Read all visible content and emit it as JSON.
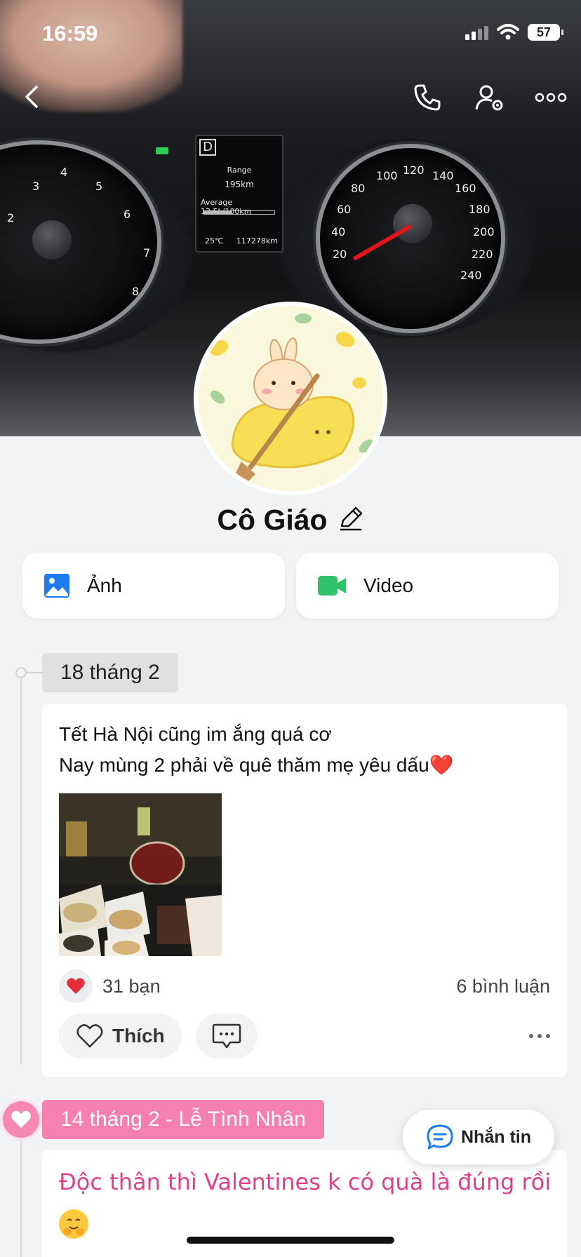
{
  "status_bar": {
    "time": "16:59",
    "battery": "57"
  },
  "profile": {
    "name": "Cô Giáo"
  },
  "actions": {
    "photo_label": "Ảnh",
    "video_label": "Video"
  },
  "posts": [
    {
      "date": "18 tháng 2",
      "text_line1": "Tết Hà Nội cũng im ắng quá cơ",
      "text_line2": "Nay mùng 2 phải về quê thăm mẹ yêu dấu❤️",
      "reactions": "31 bạn",
      "comments": "6 bình luận",
      "like_label": "Thích"
    },
    {
      "date": "14 tháng 2 - Lễ Tình Nhân",
      "text": "Độc thân thì Valentines k có quà là đúng rồi"
    }
  ],
  "message_button": {
    "label": "Nhắn tin"
  },
  "cover": {
    "lcd_gear": "D",
    "lcd_range_label": "Range",
    "lcd_range_value": "195km",
    "lcd_average": "Average 13.5L/100km",
    "lcd_temp": "25℃",
    "lcd_odo": "117278km"
  },
  "colors": {
    "accent_pink": "#f57fae",
    "valentine_text": "#e0408a",
    "photo_icon": "#1e7cf2",
    "video_icon": "#2fc26b"
  }
}
